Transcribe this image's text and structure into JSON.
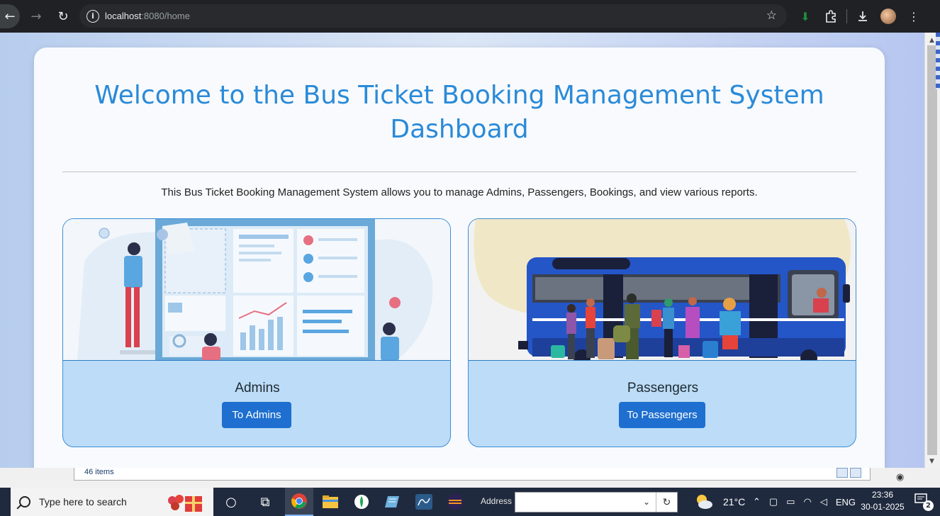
{
  "browser": {
    "url_host": "localhost",
    "url_rest": ":8080/home"
  },
  "page": {
    "title": "Welcome to the Bus Ticket Booking Management System Dashboard",
    "description": "This Bus Ticket Booking Management System allows you to manage Admins, Passengers, Bookings, and view various reports.",
    "cards": [
      {
        "name": "Admins",
        "button": "To Admins"
      },
      {
        "name": "Passengers",
        "button": "To Passengers"
      }
    ]
  },
  "explorer": {
    "items_count": "46 items"
  },
  "taskbar": {
    "search_placeholder": "Type here to search",
    "address_label": "Address",
    "temperature": "21°C",
    "language": "ENG",
    "time": "23:36",
    "date": "30-01-2025",
    "notification_count": "2"
  },
  "colors": {
    "title": "#2a8ad8",
    "button": "#1e6fcf",
    "card_footer": "#bcdcf7"
  }
}
